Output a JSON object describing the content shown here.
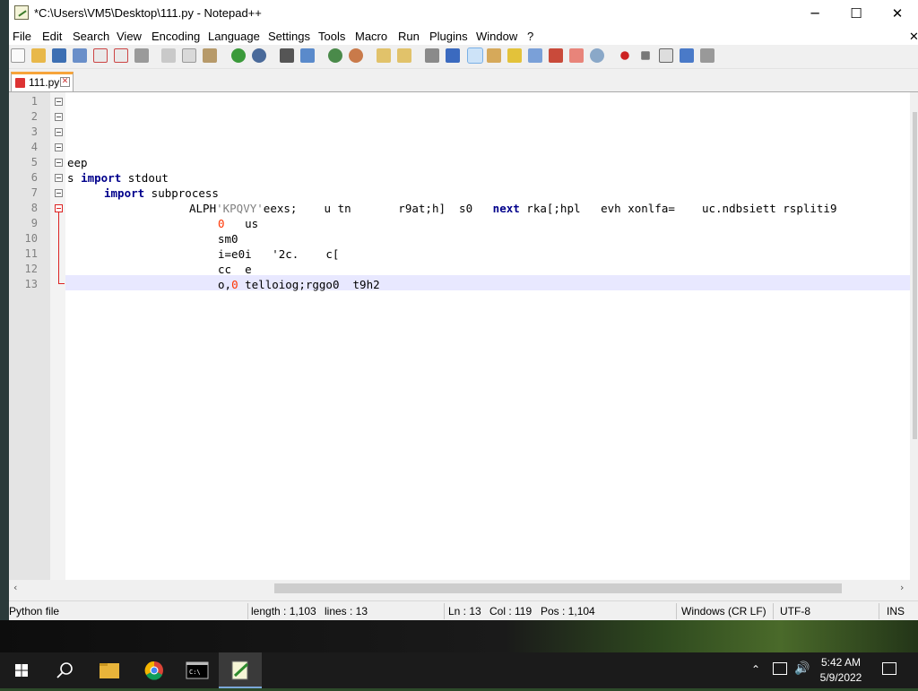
{
  "window": {
    "title": "*C:\\Users\\VM5\\Desktop\\111.py - Notepad++",
    "minimize": "─",
    "maximize": "☐",
    "close": "✕"
  },
  "menu": [
    "File",
    "Edit",
    "Search",
    "View",
    "Encoding",
    "Language",
    "Settings",
    "Tools",
    "Macro",
    "Run",
    "Plugins",
    "Window",
    "?"
  ],
  "menu_close": "✕",
  "tab": {
    "label": "111.py",
    "close": "✕"
  },
  "gutter": {
    "line_numbers": [
      "1",
      "2",
      "3",
      "4",
      "5",
      "6",
      "7",
      "8",
      "9",
      "10",
      "11",
      "12",
      "13"
    ]
  },
  "code": {
    "l5": "eep",
    "l6a": "s ",
    "l6kw": "import",
    "l6b": " stdout",
    "l7kw": "import",
    "l7b": " subprocess",
    "l8a": "ALPH",
    "l8str": "'KPQVY'",
    "l8b": "eexs;    u tn       r9at;h]  s0   ",
    "l8kw": "next",
    "l8c": " rka[;hpl   evh xonlfa=    uc.ndbsiett rspliti9",
    "l9num": "0",
    "l9b": "   us",
    "l10": "sm0",
    "l11": "i=e0i   '2c.    c[",
    "l12": "cc  e",
    "l13a": "o,",
    "l13num": "0",
    "l13b": " telloiog;rggo0  t9h2"
  },
  "status": {
    "file_type": "Python file",
    "length": "length : 1,103",
    "lines": "lines : 13",
    "ln": "Ln : 13",
    "col": "Col : 119",
    "pos": "Pos : 1,104",
    "eol": "Windows (CR LF)",
    "encoding": "UTF-8",
    "mode": "INS"
  },
  "tray": {
    "time": "5:42 AM",
    "date": "5/9/2022"
  },
  "colors": {
    "keyword": "#00008b",
    "string": "#808080",
    "number": "#ff3300",
    "current_line": "#e8e8ff",
    "tab_accent": "#f7a43a"
  }
}
